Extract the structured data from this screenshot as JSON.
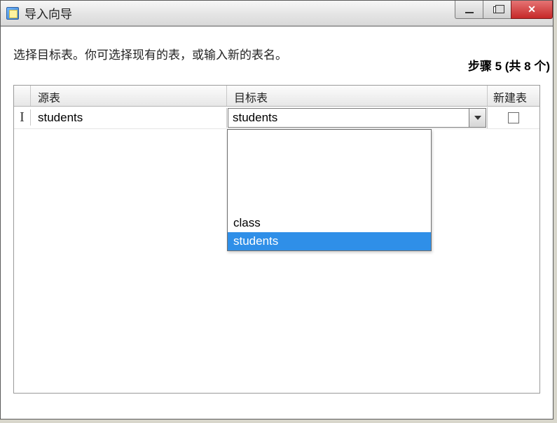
{
  "window": {
    "title": "导入向导"
  },
  "step": {
    "text": "步骤 5 (共 8 个)"
  },
  "instruction": "选择目标表。你可选择现有的表，或输入新的表名。",
  "columns": {
    "source": "源表",
    "target": "目标表",
    "new_table": "新建表"
  },
  "row": {
    "cursor_glyph": "I",
    "source_value": "students",
    "target_value": "students",
    "new_table_checked": false
  },
  "dropdown": {
    "options": [
      "class",
      "students"
    ],
    "selected_index": 1
  }
}
